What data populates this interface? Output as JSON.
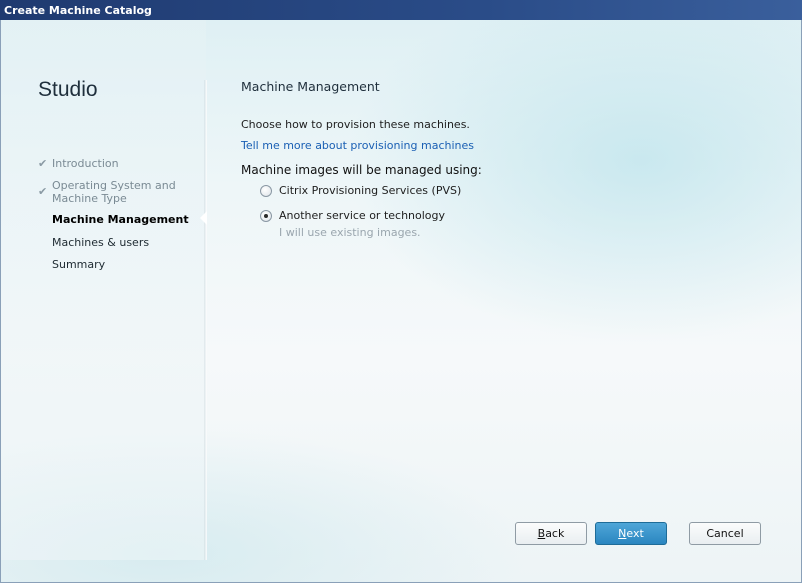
{
  "window": {
    "title": "Create Machine Catalog"
  },
  "sidebar": {
    "app_name": "Studio",
    "steps": [
      {
        "label": "Introduction",
        "state": "done"
      },
      {
        "label": "Operating System and Machine Type",
        "line1": "Operating System and",
        "line2": "Machine Type",
        "state": "done"
      },
      {
        "label": "Machine Management",
        "state": "current"
      },
      {
        "label": "Machines & users",
        "state": "pending"
      },
      {
        "label": "Summary",
        "state": "pending"
      }
    ]
  },
  "main": {
    "heading": "Machine Management",
    "intro": "Choose how to provision these machines.",
    "learn_more_link": "Tell me more about provisioning machines",
    "group_label": "Machine images will be managed using:",
    "options": [
      {
        "label": "Citrix Provisioning Services (PVS)",
        "selected": false
      },
      {
        "label": "Another service or technology",
        "selected": true,
        "hint": "I will use existing images."
      }
    ]
  },
  "footer": {
    "back": {
      "prefix": "",
      "mnemonic": "B",
      "suffix": "ack"
    },
    "next": {
      "prefix": "",
      "mnemonic": "N",
      "suffix": "ext"
    },
    "cancel": "Cancel"
  },
  "colors": {
    "titlebar": "#1f3a70",
    "link": "#1a5fb4",
    "primary_button": "#2a86c0"
  },
  "icons": {
    "step_done": "checkmark-icon",
    "radio": "radio-button"
  }
}
